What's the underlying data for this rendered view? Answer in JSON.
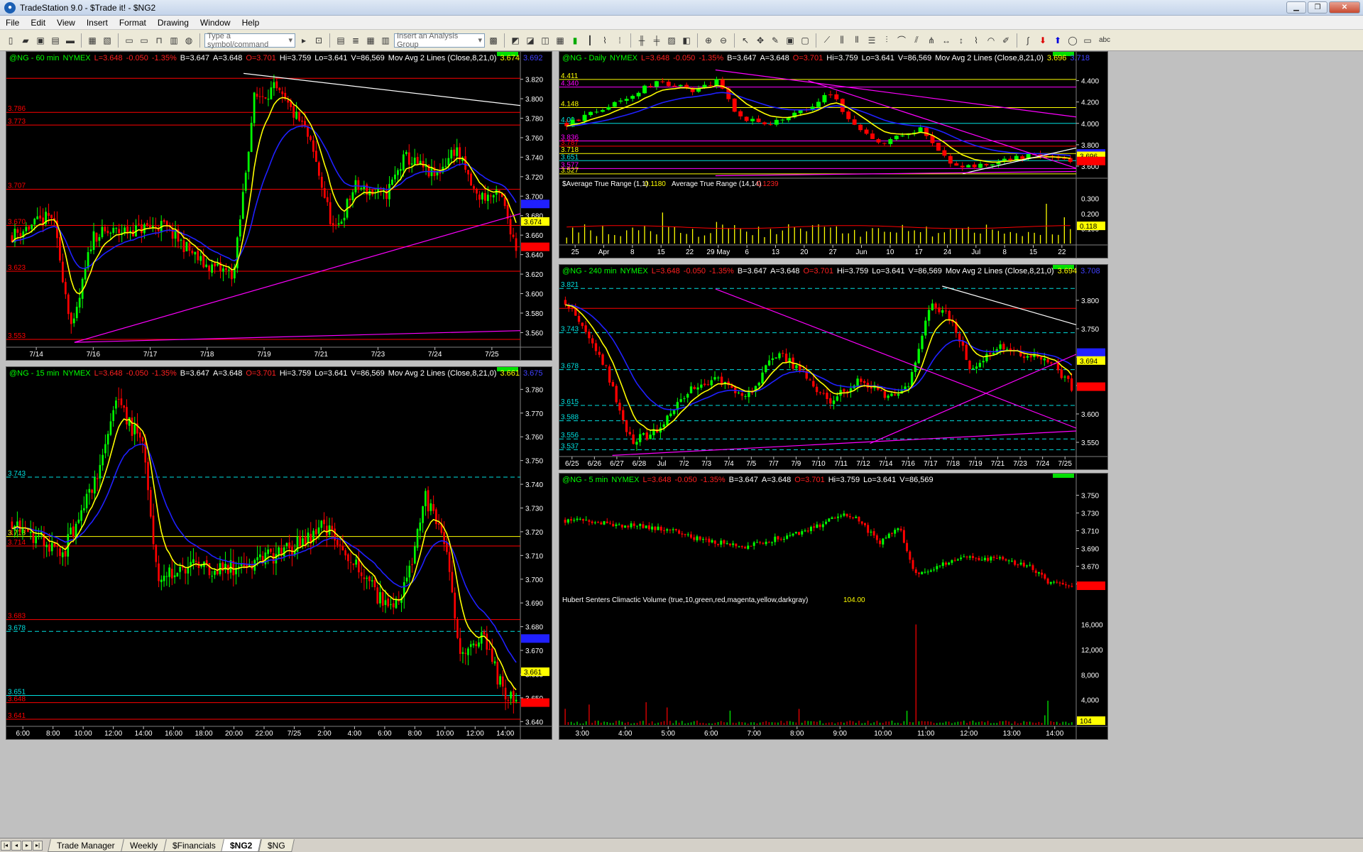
{
  "window": {
    "title": "TradeStation 9.0 - $Trade it! - $NG2"
  },
  "menu": [
    "File",
    "Edit",
    "View",
    "Insert",
    "Format",
    "Drawing",
    "Window",
    "Help"
  ],
  "toolbar": {
    "symbol_placeholder": "Type a symbol/command",
    "analysis_placeholder": "Insert an Analysis Group",
    "abc": "abc"
  },
  "tabs": [
    "Trade Manager",
    "Weekly",
    "$Financials",
    "$NG2",
    "$NG"
  ],
  "active_tab": "$NG2",
  "colors": {
    "up": "#00ff00",
    "down": "#ff0000",
    "ma_fast": "#ffff00",
    "ma_slow": "#2020ff",
    "trend": "#ff00ff",
    "support": "#00e0e0",
    "level": "#ff0000",
    "volume": "#ffff00"
  },
  "charts": [
    {
      "id": "ng60",
      "header": {
        "symbol": "@NG - 60 min",
        "exchange": "NYMEX",
        "last": "L=3.648",
        "chg": "-0.050",
        "pct": "-1.35%",
        "bid": "B=3.647",
        "ask": "A=3.648",
        "open": "O=3.701",
        "high": "Hi=3.759",
        "low": "Lo=3.641",
        "vol": "V=86,569",
        "study": "Mov Avg 2 Lines (Close,8,21,0)",
        "v1": "3.674",
        "v2": "3.692"
      },
      "ylim": [
        3.545,
        3.835
      ],
      "yticks": [
        "3.820",
        "3.800",
        "3.780",
        "3.760",
        "3.740",
        "3.720",
        "3.700",
        "3.680",
        "3.660",
        "3.640",
        "3.620",
        "3.600",
        "3.580",
        "3.560"
      ],
      "xticks": [
        "7/14",
        "7/16",
        "7/17",
        "7/18",
        "7/19",
        "7/21",
        "7/23",
        "7/24",
        "7/25"
      ],
      "levels": [
        {
          "v": 3.821,
          "label": "",
          "color": "#ff0000"
        },
        {
          "v": 3.786,
          "label": "3.786",
          "color": "#ff0000"
        },
        {
          "v": 3.773,
          "label": "3.773",
          "color": "#ff0000"
        },
        {
          "v": 3.707,
          "label": "3.707",
          "color": "#ff0000"
        },
        {
          "v": 3.67,
          "label": "3.670",
          "color": "#ff0000"
        },
        {
          "v": 3.648,
          "label": "",
          "color": "#ff0000"
        },
        {
          "v": 3.623,
          "label": "3.623",
          "color": "#ff0000"
        },
        {
          "v": 3.553,
          "label": "3.553",
          "color": "#ff0000"
        }
      ],
      "tags": [
        {
          "v": 3.692,
          "label": "3.692",
          "bg": "#2020ff",
          "fg": "#2020ff"
        },
        {
          "v": 3.674,
          "label": "3.674",
          "bg": "#ffff00",
          "fg": "#000"
        },
        {
          "v": 3.648,
          "label": "3.648",
          "bg": "#ff0000",
          "fg": "#ff0000"
        }
      ],
      "seed": 11,
      "n": 180,
      "path": [
        [
          0,
          3.66
        ],
        [
          0.08,
          3.68
        ],
        [
          0.12,
          3.56
        ],
        [
          0.16,
          3.66
        ],
        [
          0.3,
          3.67
        ],
        [
          0.38,
          3.63
        ],
        [
          0.44,
          3.62
        ],
        [
          0.48,
          3.8
        ],
        [
          0.52,
          3.81
        ],
        [
          0.58,
          3.77
        ],
        [
          0.6,
          3.74
        ],
        [
          0.64,
          3.66
        ],
        [
          0.68,
          3.71
        ],
        [
          0.74,
          3.7
        ],
        [
          0.78,
          3.74
        ],
        [
          0.84,
          3.72
        ],
        [
          0.88,
          3.75
        ],
        [
          0.92,
          3.7
        ],
        [
          0.97,
          3.7
        ],
        [
          1,
          3.648
        ]
      ],
      "lines": [
        {
          "x1": 0.46,
          "y1": 3.826,
          "x2": 1.0,
          "y2": 3.793,
          "color": "#ffffff"
        },
        {
          "x1": 0.13,
          "y1": 3.55,
          "x2": 1.0,
          "y2": 3.682,
          "color": "#ff00ff"
        },
        {
          "x1": 0.13,
          "y1": 3.55,
          "x2": 1.0,
          "y2": 3.562,
          "color": "#ff00ff"
        }
      ]
    },
    {
      "id": "ng15",
      "header": {
        "symbol": "@NG - 15 min",
        "exchange": "NYMEX",
        "last": "L=3.648",
        "chg": "-0.050",
        "pct": "-1.35%",
        "bid": "B=3.647",
        "ask": "A=3.648",
        "open": "O=3.701",
        "high": "Hi=3.759",
        "low": "Lo=3.641",
        "vol": "V=86,569",
        "study": "Mov Avg 2 Lines (Close,8,21,0)",
        "v1": "3.661",
        "v2": "3.675"
      },
      "ylim": [
        3.638,
        3.784
      ],
      "yticks": [
        "3.780",
        "3.770",
        "3.760",
        "3.750",
        "3.740",
        "3.730",
        "3.720",
        "3.710",
        "3.700",
        "3.690",
        "3.680",
        "3.670",
        "3.660",
        "3.650",
        "3.640"
      ],
      "xticks": [
        "6:00",
        "8:00",
        "10:00",
        "12:00",
        "14:00",
        "16:00",
        "18:00",
        "20:00",
        "22:00",
        "7/25",
        "2:00",
        "4:00",
        "6:00",
        "8:00",
        "10:00",
        "12:00",
        "14:00"
      ],
      "levels": [
        {
          "v": 3.743,
          "label": "3.743",
          "color": "#00e0e0",
          "dash": true
        },
        {
          "v": 3.718,
          "label": "3.718",
          "color": "#ffff00"
        },
        {
          "v": 3.714,
          "label": "3.714",
          "color": "#ff0000"
        },
        {
          "v": 3.683,
          "label": "3.683",
          "color": "#ff0000"
        },
        {
          "v": 3.678,
          "label": "3.678",
          "color": "#00e0e0",
          "dash": true
        },
        {
          "v": 3.651,
          "label": "3.651",
          "color": "#00e0e0"
        },
        {
          "v": 3.648,
          "label": "3.648",
          "color": "#ff0000"
        },
        {
          "v": 3.641,
          "label": "3.641",
          "color": "#ff0000"
        }
      ],
      "tags": [
        {
          "v": 3.675,
          "label": "3.675",
          "bg": "#2020ff",
          "fg": "#2020ff"
        },
        {
          "v": 3.661,
          "label": "3.661",
          "bg": "#ffff00",
          "fg": "#000"
        },
        {
          "v": 3.648,
          "label": "3.648",
          "bg": "#ff0000",
          "fg": "#ff0000"
        }
      ],
      "seed": 23,
      "n": 190,
      "path": [
        [
          0,
          3.725
        ],
        [
          0.1,
          3.71
        ],
        [
          0.17,
          3.745
        ],
        [
          0.21,
          3.775
        ],
        [
          0.26,
          3.755
        ],
        [
          0.29,
          3.7
        ],
        [
          0.36,
          3.705
        ],
        [
          0.44,
          3.705
        ],
        [
          0.55,
          3.712
        ],
        [
          0.62,
          3.722
        ],
        [
          0.68,
          3.708
        ],
        [
          0.74,
          3.688
        ],
        [
          0.78,
          3.696
        ],
        [
          0.82,
          3.735
        ],
        [
          0.86,
          3.712
        ],
        [
          0.89,
          3.665
        ],
        [
          0.93,
          3.678
        ],
        [
          0.97,
          3.655
        ],
        [
          1,
          3.648
        ]
      ],
      "lines": []
    },
    {
      "id": "ngD",
      "header": {
        "symbol": "@NG - Daily",
        "exchange": "NYMEX",
        "last": "L=3.648",
        "chg": "-0.050",
        "pct": "-1.35%",
        "bid": "B=3.647",
        "ask": "A=3.648",
        "open": "O=3.701",
        "high": "Hi=3.759",
        "low": "Lo=3.641",
        "vol": "V=86,569",
        "study": "Mov Avg 2 Lines (Close,8,21,0)",
        "v1": "3.696",
        "v2": "3.718"
      },
      "ylim": [
        3.5,
        4.55
      ],
      "yticks": [
        "4.400",
        "4.200",
        "4.000",
        "3.800",
        "3.600"
      ],
      "xticks": [
        "25",
        "Apr",
        "8",
        "15",
        "22",
        "29 May",
        "6",
        "13",
        "20",
        "27",
        "Jun",
        "10",
        "17",
        "24",
        "Jul",
        "8",
        "15",
        "22"
      ],
      "levels": [
        {
          "v": 4.411,
          "label": "4.411",
          "color": "#ffff00"
        },
        {
          "v": 4.34,
          "label": "4.340",
          "color": "#ff00ff"
        },
        {
          "v": 4.148,
          "label": "4.148",
          "color": "#ffff00"
        },
        {
          "v": 4.0,
          "label": "4.00",
          "color": "#00e0e0"
        },
        {
          "v": 3.836,
          "label": "3.836",
          "color": "#ff00ff"
        },
        {
          "v": 3.787,
          "label": "3.787",
          "color": "#ff0000"
        },
        {
          "v": 3.718,
          "label": "3.718",
          "color": "#ffff00"
        },
        {
          "v": 3.651,
          "label": "3.651",
          "color": "#00e0e0"
        },
        {
          "v": 3.577,
          "label": "3.577",
          "color": "#ff00ff"
        },
        {
          "v": 3.527,
          "label": "3.527",
          "color": "#ffff00"
        }
      ],
      "tags": [
        {
          "v": 3.718,
          "label": "3.718",
          "bg": "#2020ff",
          "fg": "#2020ff"
        },
        {
          "v": 3.696,
          "label": "3.696",
          "bg": "#ffff00",
          "fg": "#000"
        },
        {
          "v": 3.648,
          "label": "3.648",
          "bg": "#ff0000",
          "fg": "#ff0000"
        }
      ],
      "seed": 37,
      "n": 85,
      "path": [
        [
          0,
          4.0
        ],
        [
          0.08,
          4.15
        ],
        [
          0.18,
          4.4
        ],
        [
          0.26,
          4.3
        ],
        [
          0.3,
          4.4
        ],
        [
          0.34,
          4.05
        ],
        [
          0.4,
          3.98
        ],
        [
          0.48,
          4.15
        ],
        [
          0.52,
          4.3
        ],
        [
          0.56,
          4.05
        ],
        [
          0.62,
          3.8
        ],
        [
          0.66,
          3.88
        ],
        [
          0.7,
          3.95
        ],
        [
          0.76,
          3.64
        ],
        [
          0.8,
          3.58
        ],
        [
          0.86,
          3.66
        ],
        [
          0.92,
          3.7
        ],
        [
          0.96,
          3.72
        ],
        [
          1,
          3.648
        ]
      ],
      "lines": [
        {
          "x1": 0.3,
          "y1": 4.5,
          "x2": 1.0,
          "y2": 4.06,
          "color": "#ff00ff"
        },
        {
          "x1": 0.48,
          "y1": 4.4,
          "x2": 1.0,
          "y2": 3.58,
          "color": "#ff00ff"
        },
        {
          "x1": 0.78,
          "y1": 3.53,
          "x2": 1.0,
          "y2": 3.77,
          "color": "#ffffff"
        },
        {
          "x1": 0.3,
          "y1": 3.51,
          "x2": 1.0,
          "y2": 3.55,
          "color": "#ff00ff"
        }
      ],
      "atr": {
        "label": "$Average True Range (1,1)",
        "v1": "0.1180",
        "label2": "Average True Range (14,14)",
        "v2": "0.1239",
        "yticks": [
          "0.300",
          "0.200",
          "0.100"
        ],
        "last": "0.118",
        "ylim": [
          0.0,
          0.36
        ]
      }
    },
    {
      "id": "ng240",
      "header": {
        "symbol": "@NG - 240 min",
        "exchange": "NYMEX",
        "last": "L=3.648",
        "chg": "-0.050",
        "pct": "-1.35%",
        "bid": "B=3.647",
        "ask": "A=3.648",
        "open": "O=3.701",
        "high": "Hi=3.759",
        "low": "Lo=3.641",
        "vol": "V=86,569",
        "study": "Mov Avg 2 Lines (Close,8,21,0)",
        "v1": "3.694",
        "v2": "3.708"
      },
      "ylim": [
        3.525,
        3.84
      ],
      "yticks": [
        "3.800",
        "3.750",
        "3.700",
        "3.650",
        "3.600",
        "3.550"
      ],
      "xticks": [
        "6/25",
        "6/26",
        "6/27",
        "6/28",
        "Jul",
        "7/2",
        "7/3",
        "7/4",
        "7/5",
        "7/7",
        "7/9",
        "7/10",
        "7/11",
        "7/12",
        "7/14",
        "7/16",
        "7/17",
        "7/18",
        "7/19",
        "7/21",
        "7/23",
        "7/24",
        "7/25"
      ],
      "levels": [
        {
          "v": 3.821,
          "label": "3.821",
          "color": "#00e0e0",
          "dash": true
        },
        {
          "v": 3.786,
          "label": "",
          "color": "#ff0000"
        },
        {
          "v": 3.743,
          "label": "3.743",
          "color": "#00e0e0",
          "dash": true
        },
        {
          "v": 3.678,
          "label": "3.678",
          "color": "#00e0e0",
          "dash": true
        },
        {
          "v": 3.615,
          "label": "3.615",
          "color": "#00e0e0",
          "dash": true
        },
        {
          "v": 3.588,
          "label": "3.588",
          "color": "#00e0e0",
          "dash": true
        },
        {
          "v": 3.556,
          "label": "3.556",
          "color": "#00e0e0",
          "dash": true
        },
        {
          "v": 3.537,
          "label": "3.537",
          "color": "#00e0e0",
          "dash": true
        }
      ],
      "tags": [
        {
          "v": 3.708,
          "label": "3.708",
          "bg": "#2020ff",
          "fg": "#2020ff"
        },
        {
          "v": 3.694,
          "label": "3.694",
          "bg": "#ffff00",
          "fg": "#000"
        },
        {
          "v": 3.648,
          "label": "3.648",
          "bg": "#ff0000",
          "fg": "#ff0000"
        }
      ],
      "seed": 51,
      "n": 150,
      "path": [
        [
          0,
          3.8
        ],
        [
          0.04,
          3.75
        ],
        [
          0.08,
          3.68
        ],
        [
          0.13,
          3.55
        ],
        [
          0.18,
          3.57
        ],
        [
          0.24,
          3.64
        ],
        [
          0.3,
          3.66
        ],
        [
          0.36,
          3.63
        ],
        [
          0.42,
          3.71
        ],
        [
          0.48,
          3.66
        ],
        [
          0.52,
          3.62
        ],
        [
          0.58,
          3.66
        ],
        [
          0.64,
          3.63
        ],
        [
          0.68,
          3.65
        ],
        [
          0.72,
          3.79
        ],
        [
          0.76,
          3.77
        ],
        [
          0.8,
          3.68
        ],
        [
          0.86,
          3.72
        ],
        [
          0.9,
          3.7
        ],
        [
          0.95,
          3.7
        ],
        [
          1,
          3.648
        ]
      ],
      "lines": [
        {
          "x1": 0.3,
          "y1": 3.82,
          "x2": 1.0,
          "y2": 3.575,
          "color": "#ff00ff"
        },
        {
          "x1": 0.74,
          "y1": 3.825,
          "x2": 1.0,
          "y2": 3.757,
          "color": "#ffffff"
        },
        {
          "x1": 0.6,
          "y1": 3.548,
          "x2": 1.0,
          "y2": 3.705,
          "color": "#ff00ff"
        },
        {
          "x1": 0.1,
          "y1": 3.527,
          "x2": 1.0,
          "y2": 3.57,
          "color": "#ff00ff"
        }
      ]
    },
    {
      "id": "ng5",
      "header": {
        "symbol": "@NG - 5 min",
        "exchange": "NYMEX",
        "last": "L=3.648",
        "chg": "-0.050",
        "pct": "-1.35%",
        "bid": "B=3.647",
        "ask": "A=3.648",
        "open": "O=3.701",
        "high": "Hi=3.759",
        "low": "Lo=3.641",
        "vol": "V=86,569",
        "study": "",
        "v1": "",
        "v2": ""
      },
      "ylim": [
        3.64,
        3.76
      ],
      "yticks": [
        "3.750",
        "3.730",
        "3.710",
        "3.690",
        "3.670",
        "3.650"
      ],
      "xticks": [
        "3:00",
        "4:00",
        "5:00",
        "6:00",
        "7:00",
        "8:00",
        "9:00",
        "10:00",
        "11:00",
        "12:00",
        "13:00",
        "14:00"
      ],
      "levels": [],
      "tags": [
        {
          "v": 3.648,
          "label": "3.648",
          "bg": "#ff0000",
          "fg": "#ff0000"
        }
      ],
      "seed": 67,
      "n": 170,
      "path": [
        [
          0,
          3.722
        ],
        [
          0.12,
          3.716
        ],
        [
          0.2,
          3.712
        ],
        [
          0.25,
          3.702
        ],
        [
          0.35,
          3.692
        ],
        [
          0.45,
          3.705
        ],
        [
          0.55,
          3.728
        ],
        [
          0.58,
          3.722
        ],
        [
          0.62,
          3.695
        ],
        [
          0.66,
          3.715
        ],
        [
          0.69,
          3.66
        ],
        [
          0.74,
          3.672
        ],
        [
          0.8,
          3.68
        ],
        [
          0.86,
          3.678
        ],
        [
          0.92,
          3.67
        ],
        [
          0.95,
          3.652
        ],
        [
          1,
          3.648
        ]
      ],
      "lines": [],
      "vol": {
        "label": "Hubert Senters Climactic Volume (true,10,green,red,magenta,yellow,darkgray)",
        "value": "104.00",
        "yticks": [
          "16,000",
          "12,000",
          "8,000",
          "4,000"
        ],
        "last": "104",
        "ylim": [
          0,
          19000
        ]
      }
    }
  ]
}
